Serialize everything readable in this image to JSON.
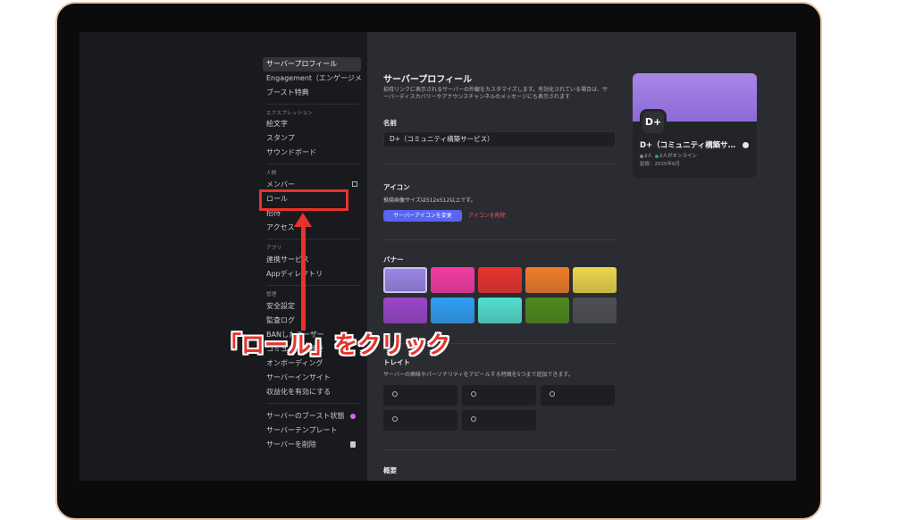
{
  "nav": {
    "server_profile": "サーバープロフィール",
    "engagement": "Engagement（エンゲージメ…",
    "boost_perks": "ブースト特典",
    "expression_header": "エクスプレッション",
    "emoji": "絵文字",
    "stamps": "スタンプ",
    "soundboard": "サウンドボード",
    "people_header": "人間",
    "members": "メンバー",
    "roles": "ロール",
    "invites": "招待",
    "access": "アクセス",
    "apps_header": "アプリ",
    "integrations": "連携サービス",
    "app_directory": "Appディレクトリ",
    "moderation_header": "管理",
    "safety_setup": "安全設定",
    "audit_log": "監査ログ",
    "bans": "BANしたユーザー",
    "community_overview": "コミュニティ概要",
    "onboarding": "オンボーディング",
    "server_insights": "サーバーインサイト",
    "enable_monetization": "収益化を有効にする",
    "server_boost_status": "サーバーのブースト状態",
    "server_template": "サーバーテンプレート",
    "delete_server": "サーバーを削除"
  },
  "content": {
    "title": "サーバープロフィール",
    "description": "招待リンクに表示されるサーバーの外観をカスタマイズします。有効化されている場合は、サーバーディスカバリーやアナウンスチャンネルのメッセージにも表示されます",
    "name_label": "名前",
    "name_value": "D+（コミュニティ構築サービス）",
    "icon_label": "アイコン",
    "icon_note": "推奨画像サイズは512x512以上です。",
    "change_icon_button": "サーバーアイコンを変更",
    "remove_icon_button": "アイコンを削除",
    "banner_label": "バナー",
    "banner_colors": [
      "#9a86e6",
      "#f53aa5",
      "#e8332f",
      "#f07d2a",
      "#eed64a",
      "#9b45c9",
      "#2f9ff3",
      "#52e0cf",
      "#4f8a1c",
      "#4d4f54"
    ],
    "traits_label": "トレイト",
    "traits_desc": "サーバーの興味やパーソナリティをアピールする特徴を5つまで追加できます。",
    "overview_label": "概要"
  },
  "preview": {
    "avatar_text": "D+",
    "server_name": "D+（コミュニティ構築サ…",
    "members": "2人",
    "online": "2人がオンライン",
    "created": "創設：2025年6月"
  },
  "annotation": {
    "callout": "「ロール」をクリック",
    "color": "#e8322c"
  }
}
